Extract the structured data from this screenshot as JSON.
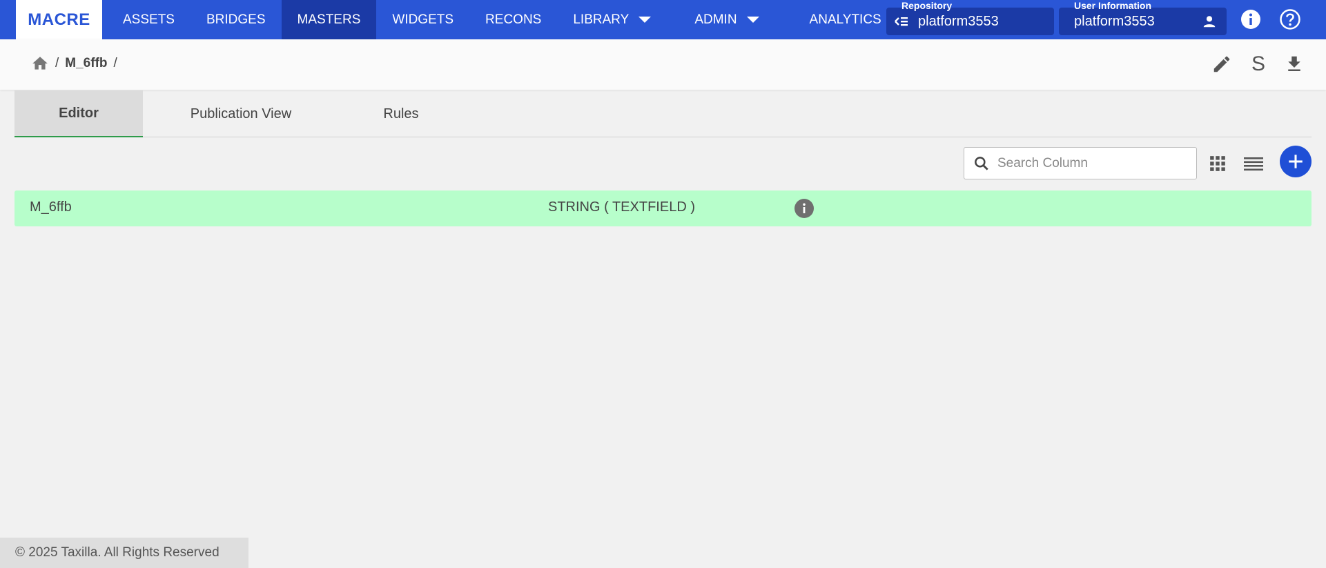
{
  "nav": {
    "brand": "MACRE",
    "items": [
      {
        "label": "ASSETS"
      },
      {
        "label": "BRIDGES"
      },
      {
        "label": "MASTERS"
      },
      {
        "label": "WIDGETS"
      },
      {
        "label": "RECONS"
      },
      {
        "label": "LIBRARY"
      },
      {
        "label": "ADMIN"
      },
      {
        "label": "ANALYTICS"
      }
    ],
    "active": "MASTERS",
    "repository": {
      "label": "Repository",
      "value": "platform3553"
    },
    "user": {
      "label": "User Information",
      "value": "platform3553"
    },
    "icons": [
      "repository-switch-icon",
      "user-icon",
      "info-icon",
      "help-icon"
    ]
  },
  "breadcrumb": {
    "items": [
      "M_6ffb"
    ],
    "separator": "/",
    "tools": [
      "edit-icon",
      "s-icon",
      "download-icon"
    ],
    "s_label": "S"
  },
  "tabs": [
    {
      "label": "Editor",
      "active": true
    },
    {
      "label": "Publication View"
    },
    {
      "label": "Rules"
    }
  ],
  "search": {
    "placeholder": "Search Column"
  },
  "columns": [
    {
      "name": "M_6ffb",
      "type": "STRING ( TEXTFIELD )"
    }
  ],
  "footer": {
    "text": "© 2025 Taxilla. All Rights Reserved"
  },
  "colors": {
    "nav": "#2a56d6",
    "nav_active": "#1b3aa6",
    "row_highlight": "#b7fecb",
    "tab_indicator": "#2e9b4a"
  }
}
